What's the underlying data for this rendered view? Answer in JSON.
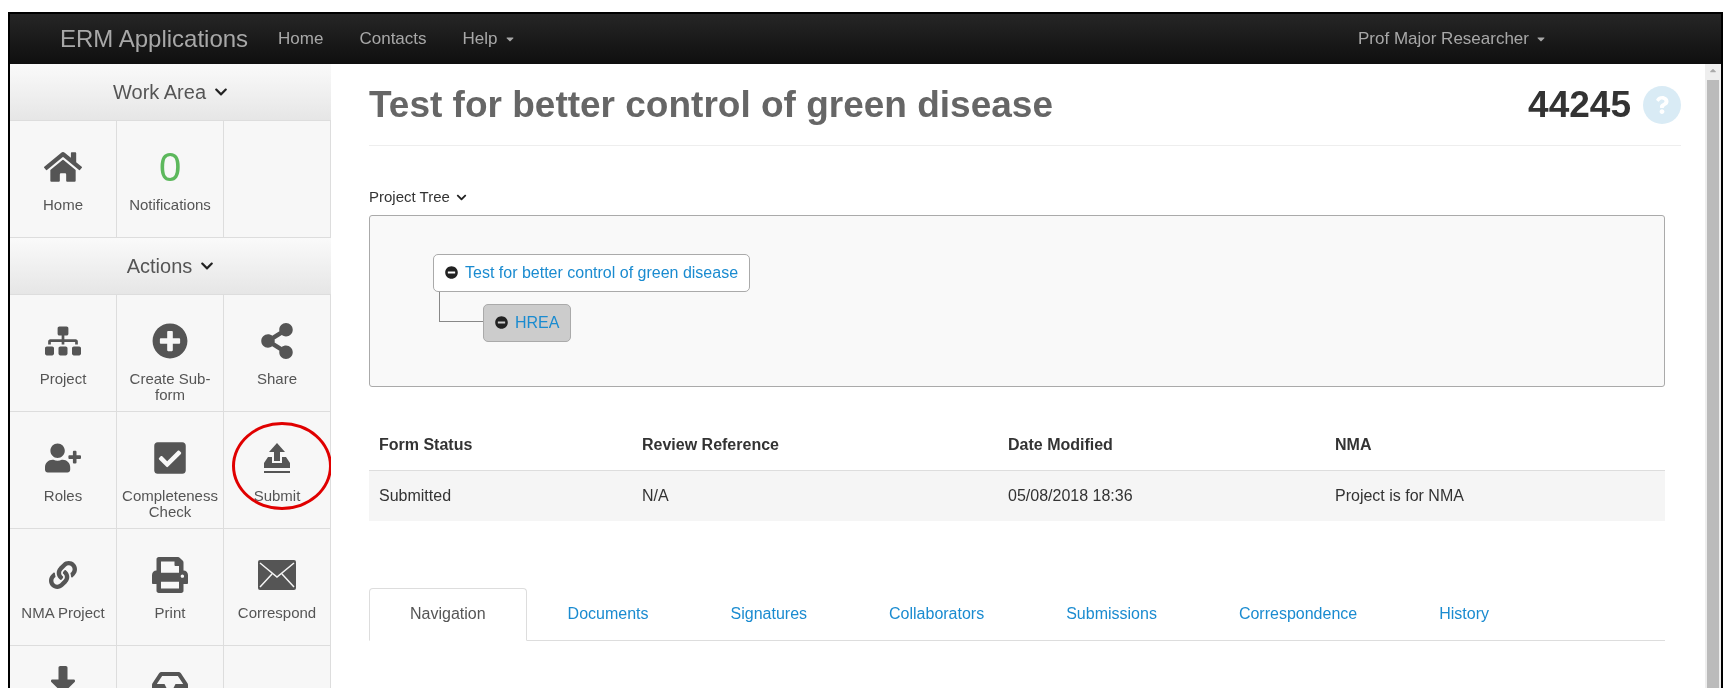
{
  "navbar": {
    "brand": "ERM Applications",
    "links": [
      {
        "label": "Home",
        "dropdown": false
      },
      {
        "label": "Contacts",
        "dropdown": false
      },
      {
        "label": "Help",
        "dropdown": true
      }
    ],
    "user": "Prof Major Researcher"
  },
  "sidebar": {
    "sections": [
      {
        "title": "Work Area",
        "items": [
          {
            "label": "Home"
          },
          {
            "label": "Notifications",
            "count": "0"
          }
        ]
      },
      {
        "title": "Actions",
        "items": [
          {
            "label": "Project"
          },
          {
            "label": "Create Sub-form"
          },
          {
            "label": "Share"
          },
          {
            "label": "Roles"
          },
          {
            "label": "Completeness Check"
          },
          {
            "label": "Submit",
            "highlighted": true
          },
          {
            "label": "NMA Project"
          },
          {
            "label": "Print"
          },
          {
            "label": "Correspond"
          }
        ]
      }
    ]
  },
  "page": {
    "title": "Test for better control of green disease",
    "project_number": "44245"
  },
  "project_tree": {
    "label": "Project Tree",
    "nodes": [
      {
        "label": "Test for better control of green disease",
        "selected": false,
        "children": [
          {
            "label": "HREA",
            "selected": true
          }
        ]
      }
    ]
  },
  "table": {
    "columns": [
      "Form Status",
      "Review Reference",
      "Date Modified",
      "NMA"
    ],
    "rows": [
      [
        "Submitted",
        "N/A",
        "05/08/2018 18:36",
        "Project is for NMA"
      ]
    ]
  },
  "tabs": [
    {
      "label": "Navigation",
      "selected": true
    },
    {
      "label": "Documents",
      "selected": false
    },
    {
      "label": "Signatures",
      "selected": false
    },
    {
      "label": "Collaborators",
      "selected": false
    },
    {
      "label": "Submissions",
      "selected": false
    },
    {
      "label": "Correspondence",
      "selected": false
    },
    {
      "label": "History",
      "selected": false
    }
  ]
}
